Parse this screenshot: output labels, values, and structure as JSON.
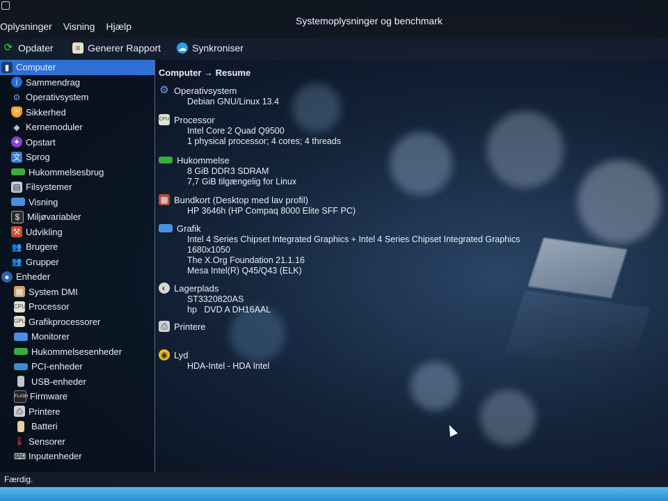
{
  "window": {
    "title": "Systemoplysninger og benchmark"
  },
  "menubar": [
    "Oplysninger",
    "Visning",
    "Hjælp"
  ],
  "toolbar": {
    "refresh_label": "Opdater",
    "report_label": "Generer Rapport",
    "sync_label": "Synkroniser"
  },
  "sidebar": {
    "items": [
      {
        "label": "Computer",
        "icon": "computer-icon",
        "selected": true
      },
      {
        "label": "Sammendrag",
        "icon": "info-icon"
      },
      {
        "label": "Operativsystem",
        "icon": "gear-icon"
      },
      {
        "label": "Sikkerhed",
        "icon": "shield-icon"
      },
      {
        "label": "Kernemoduler",
        "icon": "puzzle-icon"
      },
      {
        "label": "Opstart",
        "icon": "rocket-icon"
      },
      {
        "label": "Sprog",
        "icon": "language-icon"
      },
      {
        "label": "Hukommelsesbrug",
        "icon": "memory-icon"
      },
      {
        "label": "Filsystemer",
        "icon": "filesystem-icon"
      },
      {
        "label": "Visning",
        "icon": "display-icon"
      },
      {
        "label": "Miljøvariabler",
        "icon": "terminal-icon"
      },
      {
        "label": "Udvikling",
        "icon": "development-icon"
      },
      {
        "label": "Brugere",
        "icon": "users-icon"
      },
      {
        "label": "Grupper",
        "icon": "groups-icon"
      },
      {
        "label": "Enheder",
        "icon": "devices-icon"
      },
      {
        "label": "System DMI",
        "icon": "dmi-icon"
      },
      {
        "label": "Processor",
        "icon": "cpu-icon"
      },
      {
        "label": "Grafikprocessorer",
        "icon": "gpu-icon"
      },
      {
        "label": "Monitorer",
        "icon": "monitor-icon"
      },
      {
        "label": "Hukommelsesenheder",
        "icon": "ram-icon"
      },
      {
        "label": "PCI-enheder",
        "icon": "pci-icon"
      },
      {
        "label": "USB-enheder",
        "icon": "usb-icon"
      },
      {
        "label": "Firmware",
        "icon": "firmware-icon"
      },
      {
        "label": "Printere",
        "icon": "printer-icon"
      },
      {
        "label": "Batteri",
        "icon": "battery-icon"
      },
      {
        "label": "Sensorer",
        "icon": "thermometer-icon"
      },
      {
        "label": "Inputenheder",
        "icon": "input-icon"
      }
    ]
  },
  "main": {
    "breadcrumb": "Computer → Resume",
    "sections": [
      {
        "title": "Operativsystem",
        "icon": "gear-icon",
        "lines": [
          "Debian GNU/Linux 13.4"
        ]
      },
      {
        "title": "Processor",
        "icon": "cpu-icon",
        "lines": [
          "Intel Core 2 Quad Q9500",
          "1 physical processor; 4 cores; 4 threads"
        ]
      },
      {
        "title": "Hukommelse",
        "icon": "memory-icon",
        "lines": [
          "8 GiB DDR3 SDRAM",
          "7,7 GiB tilgængelig for Linux"
        ]
      },
      {
        "title": "Bundkort (Desktop med lav profil)",
        "icon": "motherboard-icon",
        "lines": [
          "HP 3646h (HP Compaq 8000 Elite SFF PC)"
        ]
      },
      {
        "title": "Grafik",
        "icon": "monitor-icon",
        "lines": [
          "Intel 4 Series Chipset Integrated Graphics + Intel 4 Series Chipset Integrated Graphics",
          "1680x1050",
          "The X.Org Foundation 21.1.16",
          "Mesa Intel(R) Q45/Q43 (ELK)"
        ]
      },
      {
        "title": "Lagerplads",
        "icon": "harddisk-icon",
        "lines": [
          "ST3320820AS",
          "hp   DVD A DH16AAL"
        ]
      },
      {
        "title": "Printere",
        "icon": "printer-icon",
        "lines": []
      },
      {
        "title": "Lyd",
        "icon": "audio-icon",
        "lines": [
          "HDA-Intel - HDA Intel"
        ]
      }
    ]
  },
  "status": {
    "text": "Færdig."
  },
  "colors": {
    "selection": "#2f6fd6"
  }
}
